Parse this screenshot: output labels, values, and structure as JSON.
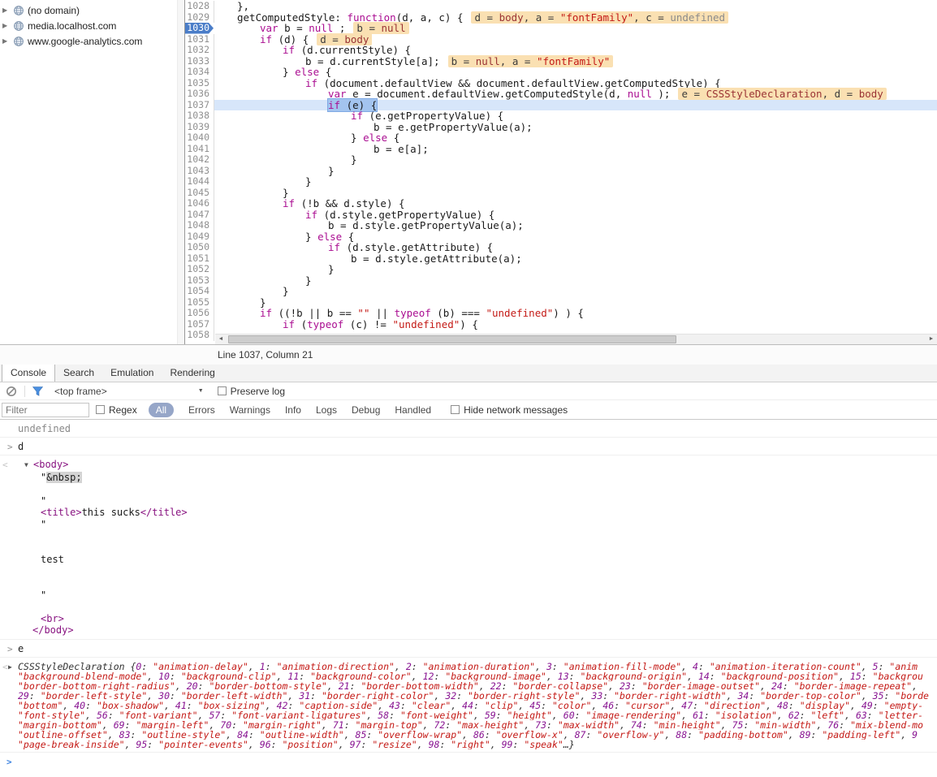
{
  "colors": {
    "keyword": "#aa0d91",
    "string": "#c41a16",
    "dom_tag": "#881280",
    "execution_line_bg": "#d7e6fa",
    "execution_token_bg": "#a3c4ef",
    "breakpoint_bg": "#4a7dc8",
    "annotation_bg": "#fae0b2",
    "active_filter_bg": "#96a6c8",
    "funnel_blue": "#4a90e2",
    "muted_text": "#888888"
  },
  "icons": {
    "collapsed": "▶",
    "expanded": "▼",
    "caret": "▼",
    "input_marker": ">",
    "result_marker": "<",
    "prompt": ">",
    "scroll_left": "◄",
    "scroll_right": "►"
  },
  "sidebar": {
    "items": [
      {
        "label": "(no domain)"
      },
      {
        "label": "media.localhost.com"
      },
      {
        "label": "www.google-analytics.com"
      }
    ]
  },
  "editor": {
    "status": "Line 1037, Column 21",
    "breakpoint_line": 1030,
    "execution_line": 1037,
    "lines": [
      {
        "n": 1028,
        "i": 1,
        "t": [
          [
            "p",
            "},"
          ]
        ]
      },
      {
        "n": 1029,
        "i": 1,
        "t": [
          [
            "p",
            "getComputedStyle: "
          ],
          [
            "k",
            "function"
          ],
          [
            "p",
            "(d, a, c) {"
          ]
        ],
        "a": [
          [
            "p",
            "d = "
          ],
          [
            "v",
            "body"
          ],
          [
            "p",
            ", a = "
          ],
          [
            "s",
            "\"fontFamily\""
          ],
          [
            "p",
            ", c = "
          ],
          [
            "u",
            "undefined"
          ]
        ]
      },
      {
        "n": 1030,
        "i": 2,
        "bp": true,
        "t": [
          [
            "k",
            "var"
          ],
          [
            "p",
            " b = "
          ],
          [
            "k",
            "null"
          ],
          [
            "p",
            " ;"
          ]
        ],
        "a": [
          [
            "p",
            "b = "
          ],
          [
            "v",
            "null"
          ]
        ]
      },
      {
        "n": 1031,
        "i": 2,
        "t": [
          [
            "k",
            "if"
          ],
          [
            "p",
            " (d) {"
          ]
        ],
        "a": [
          [
            "p",
            "d = "
          ],
          [
            "v",
            "body"
          ]
        ]
      },
      {
        "n": 1032,
        "i": 3,
        "t": [
          [
            "k",
            "if"
          ],
          [
            "p",
            " (d.currentStyle) {"
          ]
        ]
      },
      {
        "n": 1033,
        "i": 4,
        "t": [
          [
            "p",
            "b = d.currentStyle[a];"
          ]
        ],
        "a": [
          [
            "p",
            "b = "
          ],
          [
            "v",
            "null"
          ],
          [
            "p",
            ", a = "
          ],
          [
            "s",
            "\"fontFamily\""
          ]
        ]
      },
      {
        "n": 1034,
        "i": 3,
        "t": [
          [
            "p",
            "} "
          ],
          [
            "k",
            "else"
          ],
          [
            "p",
            " {"
          ]
        ]
      },
      {
        "n": 1035,
        "i": 4,
        "t": [
          [
            "k",
            "if"
          ],
          [
            "p",
            " (document.defaultView && document.defaultView.getComputedStyle) {"
          ]
        ]
      },
      {
        "n": 1036,
        "i": 5,
        "t": [
          [
            "k",
            "var"
          ],
          [
            "p",
            " e = document.defaultView.getComputedStyle(d, "
          ],
          [
            "k",
            "null"
          ],
          [
            "p",
            " );"
          ]
        ],
        "a": [
          [
            "p",
            "e = "
          ],
          [
            "v",
            "CSSStyleDeclaration"
          ],
          [
            "p",
            ", d = "
          ],
          [
            "v",
            "body"
          ]
        ]
      },
      {
        "n": 1037,
        "i": 5,
        "exec": true,
        "t": [
          [
            "k",
            "if"
          ],
          [
            "p",
            " (e) {"
          ]
        ]
      },
      {
        "n": 1038,
        "i": 6,
        "t": [
          [
            "k",
            "if"
          ],
          [
            "p",
            " (e.getPropertyValue) {"
          ]
        ]
      },
      {
        "n": 1039,
        "i": 7,
        "t": [
          [
            "p",
            "b = e.getPropertyValue(a);"
          ]
        ]
      },
      {
        "n": 1040,
        "i": 6,
        "t": [
          [
            "p",
            "} "
          ],
          [
            "k",
            "else"
          ],
          [
            "p",
            " {"
          ]
        ]
      },
      {
        "n": 1041,
        "i": 7,
        "t": [
          [
            "p",
            "b = e[a];"
          ]
        ]
      },
      {
        "n": 1042,
        "i": 6,
        "t": [
          [
            "p",
            "}"
          ]
        ]
      },
      {
        "n": 1043,
        "i": 5,
        "t": [
          [
            "p",
            "}"
          ]
        ]
      },
      {
        "n": 1044,
        "i": 4,
        "t": [
          [
            "p",
            "}"
          ]
        ]
      },
      {
        "n": 1045,
        "i": 3,
        "t": [
          [
            "p",
            "}"
          ]
        ]
      },
      {
        "n": 1046,
        "i": 3,
        "t": [
          [
            "k",
            "if"
          ],
          [
            "p",
            " (!b && d.style) {"
          ]
        ]
      },
      {
        "n": 1047,
        "i": 4,
        "t": [
          [
            "k",
            "if"
          ],
          [
            "p",
            " (d.style.getPropertyValue) {"
          ]
        ]
      },
      {
        "n": 1048,
        "i": 5,
        "t": [
          [
            "p",
            "b = d.style.getPropertyValue(a);"
          ]
        ]
      },
      {
        "n": 1049,
        "i": 4,
        "t": [
          [
            "p",
            "} "
          ],
          [
            "k",
            "else"
          ],
          [
            "p",
            " {"
          ]
        ]
      },
      {
        "n": 1050,
        "i": 5,
        "t": [
          [
            "k",
            "if"
          ],
          [
            "p",
            " (d.style.getAttribute) {"
          ]
        ]
      },
      {
        "n": 1051,
        "i": 6,
        "t": [
          [
            "p",
            "b = d.style.getAttribute(a);"
          ]
        ]
      },
      {
        "n": 1052,
        "i": 5,
        "t": [
          [
            "p",
            "}"
          ]
        ]
      },
      {
        "n": 1053,
        "i": 4,
        "t": [
          [
            "p",
            "}"
          ]
        ]
      },
      {
        "n": 1054,
        "i": 3,
        "t": [
          [
            "p",
            "}"
          ]
        ]
      },
      {
        "n": 1055,
        "i": 2,
        "t": [
          [
            "p",
            "}"
          ]
        ]
      },
      {
        "n": 1056,
        "i": 2,
        "t": [
          [
            "k",
            "if"
          ],
          [
            "p",
            " ((!b || b == "
          ],
          [
            "s",
            "\"\""
          ],
          [
            "p",
            " || "
          ],
          [
            "k",
            "typeof"
          ],
          [
            "p",
            " (b) === "
          ],
          [
            "s",
            "\"undefined\""
          ],
          [
            "p",
            ") ) {"
          ]
        ]
      },
      {
        "n": 1057,
        "i": 3,
        "t": [
          [
            "k",
            "if"
          ],
          [
            "p",
            " ("
          ],
          [
            "k",
            "typeof"
          ],
          [
            "p",
            " (c) != "
          ],
          [
            "s",
            "\"undefined\""
          ],
          [
            "p",
            ") {"
          ]
        ]
      },
      {
        "n": 1058,
        "i": 0,
        "t": []
      }
    ]
  },
  "drawer": {
    "tabs": [
      "Console",
      "Search",
      "Emulation",
      "Rendering"
    ],
    "active_tab": "Console",
    "toolbar": {
      "frame_selector": "<top frame>",
      "preserve_log": "Preserve log",
      "filter_placeholder": "Filter",
      "regex": "Regex",
      "levels": [
        "All",
        "Errors",
        "Warnings",
        "Info",
        "Logs",
        "Debug",
        "Handled"
      ],
      "active_level": "All",
      "hide_network": "Hide network messages"
    }
  },
  "console": {
    "messages": [
      {
        "type": "result",
        "text": "undefined"
      },
      {
        "type": "input",
        "text": "d"
      },
      {
        "type": "dom",
        "open": "<body>",
        "close": "</body>",
        "lines": [
          [
            [
              "t",
              "\""
            ],
            [
              "h",
              "&nbsp;"
            ]
          ],
          [],
          [
            [
              "t",
              "\""
            ]
          ],
          [
            [
              "g",
              "<title>"
            ],
            [
              "t",
              "this sucks"
            ],
            [
              "g",
              "</title>"
            ]
          ],
          [
            [
              "t",
              "\""
            ]
          ],
          [],
          [],
          [
            [
              "t",
              "test"
            ]
          ],
          [],
          [],
          [
            [
              "t",
              "\""
            ]
          ],
          [],
          [
            [
              "g",
              "<br>"
            ]
          ]
        ]
      },
      {
        "type": "input",
        "text": "e"
      },
      {
        "type": "preview",
        "lines": [
          "CSSStyleDeclaration {0: \"animation-delay\", 1: \"animation-direction\", 2: \"animation-duration\", 3: \"animation-fill-mode\", 4: \"animation-iteration-count\", 5: \"anim",
          "\"background-blend-mode\", 10: \"background-clip\", 11: \"background-color\", 12: \"background-image\", 13: \"background-origin\", 14: \"background-position\", 15: \"backgrou",
          "\"border-bottom-right-radius\", 20: \"border-bottom-style\", 21: \"border-bottom-width\", 22: \"border-collapse\", 23: \"border-image-outset\", 24: \"border-image-repeat\", ",
          "29: \"border-left-style\", 30: \"border-left-width\", 31: \"border-right-color\", 32: \"border-right-style\", 33: \"border-right-width\", 34: \"border-top-color\", 35: \"borde",
          "\"bottom\", 40: \"box-shadow\", 41: \"box-sizing\", 42: \"caption-side\", 43: \"clear\", 44: \"clip\", 45: \"color\", 46: \"cursor\", 47: \"direction\", 48: \"display\", 49: \"empty-",
          "\"font-style\", 56: \"font-variant\", 57: \"font-variant-ligatures\", 58: \"font-weight\", 59: \"height\", 60: \"image-rendering\", 61: \"isolation\", 62: \"left\", 63: \"letter-",
          "\"margin-bottom\", 69: \"margin-left\", 70: \"margin-right\", 71: \"margin-top\", 72: \"max-height\", 73: \"max-width\", 74: \"min-height\", 75: \"min-width\", 76: \"mix-blend-mo",
          "\"outline-offset\", 83: \"outline-style\", 84: \"outline-width\", 85: \"overflow-wrap\", 86: \"overflow-x\", 87: \"overflow-y\", 88: \"padding-bottom\", 89: \"padding-left\", 9",
          "\"page-break-inside\", 95: \"pointer-events\", 96: \"position\", 97: \"resize\", 98: \"right\", 99: \"speak\"…}"
        ]
      },
      {
        "type": "prompt"
      }
    ]
  }
}
